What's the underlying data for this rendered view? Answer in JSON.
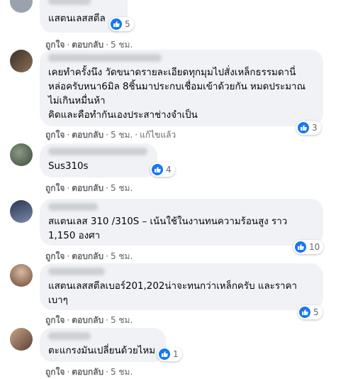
{
  "colors": {
    "link": "#1877f2",
    "bubble": "#f0f2f5",
    "meta": "#65676b"
  },
  "actions": {
    "like": "ถูกใจ",
    "reply": "ตอบกลับ",
    "edited": "แก้ไขแล้ว",
    "dot": "·"
  },
  "comments": [
    {
      "text": "แสตนเลสสตีล",
      "time": "5 ชม.",
      "reactions": "5",
      "reaction_icon": "like-icon"
    },
    {
      "text": "เคยทำครั้งนึง วัดขนาดรายละเอียดทุกมุมไปสั่งเหล็กธรรมดานี่\nหล่อครับหนา6มิล 8ชิ้นมาประกบเชื่อมเข้าด้วยกัน หมดประมาณ\nไม่เกินหมื่นห้า\nคิดและคือทำกันเองประสาช่างจำเป็น",
      "time": "5 ชม.",
      "reactions": "3",
      "reaction_icon": "like-icon"
    },
    {
      "text": "Sus310s",
      "time": "5 ชม.",
      "reactions": "4",
      "reaction_icon": "like-icon"
    },
    {
      "text": "สแตนเลส 310 /310S – เน้นใช้ในงานทนความร้อนสูง ราว\n1,150 องศา",
      "time": "5 ชม.",
      "reactions": "10",
      "reaction_icon": "like-icon"
    },
    {
      "text": "แสตนเลสสตีลเบอร์201,202น่าจะทนกว่าเหล็กครับ และราคา\nเบาๆ",
      "time": "5 ชม.",
      "reactions": "5",
      "reaction_icon": "like-icon"
    },
    {
      "text": "ตะแกรงมันเปลี่ยนด้วยไหม",
      "time": "5 ชม.",
      "reactions": "1",
      "reaction_icon": "like-icon"
    }
  ]
}
